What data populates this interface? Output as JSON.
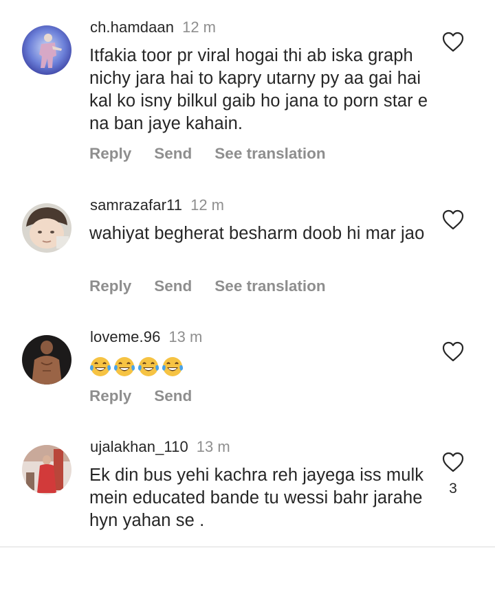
{
  "comments": [
    {
      "username": "ch.hamdaan",
      "time": "12 m",
      "text": "Itfakia toor pr viral hogai thi ab iska graph nichy jara hai to kapry utarny py aa gai hai kal ko isny bilkul gaib ho jana to porn star e na ban jaye kahain.",
      "actions": [
        "Reply",
        "Send",
        "See translation"
      ],
      "avatar": "avatar-standing-person"
    },
    {
      "username": "samrazafar11",
      "time": "12 m",
      "text": "wahiyat begherat besharm doob hi mar jao",
      "actions": [
        "Reply",
        "Send",
        "See translation"
      ],
      "avatar": "avatar-baby-in-cap"
    },
    {
      "username": "loveme.96",
      "time": "13 m",
      "emojis": [
        "😂",
        "😂",
        "😂",
        "😂"
      ],
      "actions": [
        "Reply",
        "Send"
      ],
      "avatar": "avatar-shirtless-man"
    },
    {
      "username": "ujalakhan_110",
      "time": "13 m",
      "text": "Ek din bus yehi kachra reh jayega iss mulk mein educated bande tu wessi bahr jarahe hyn yahan se .",
      "like_count": "3",
      "avatar": "avatar-woman-red-dress"
    }
  ],
  "icons": {
    "like": "heart-outline-icon",
    "emoji": "face-with-tears-of-joy"
  },
  "colors": {
    "text": "#262626",
    "secondary": "#8e8e8e",
    "divider": "#dbdbdb",
    "emoji_yellow": "#f6c343"
  }
}
